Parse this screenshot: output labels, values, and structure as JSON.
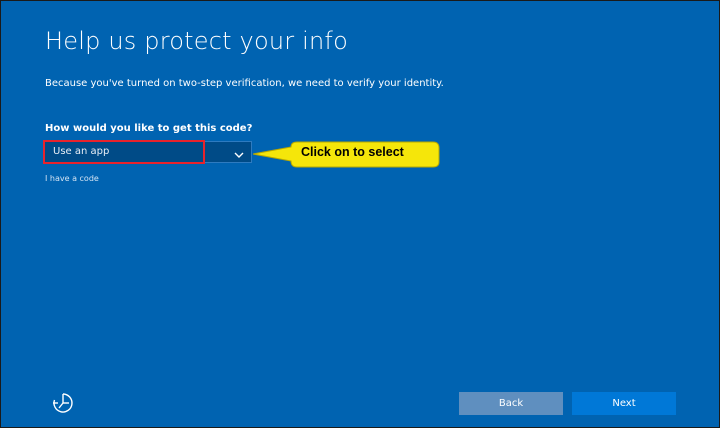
{
  "page": {
    "title": "Help us protect your info",
    "subtitle": "Because you've turned on two-step verification, we need to verify your identity.",
    "question": "How would you like to get this code?"
  },
  "dropdown": {
    "selected": "Use an app",
    "icon": "chevron-down-icon"
  },
  "annotation": {
    "callout_text": "Click on to select",
    "callout_color": "#f5e60a",
    "highlight_color": "#e8232c"
  },
  "links": {
    "have_code": "I have a code"
  },
  "footer": {
    "accessibility_icon": "ease-of-access-icon",
    "back_label": "Back",
    "next_label": "Next"
  },
  "colors": {
    "background": "#0063b1",
    "primary_button": "#0078d7",
    "secondary_button": "#5f8fbf"
  }
}
